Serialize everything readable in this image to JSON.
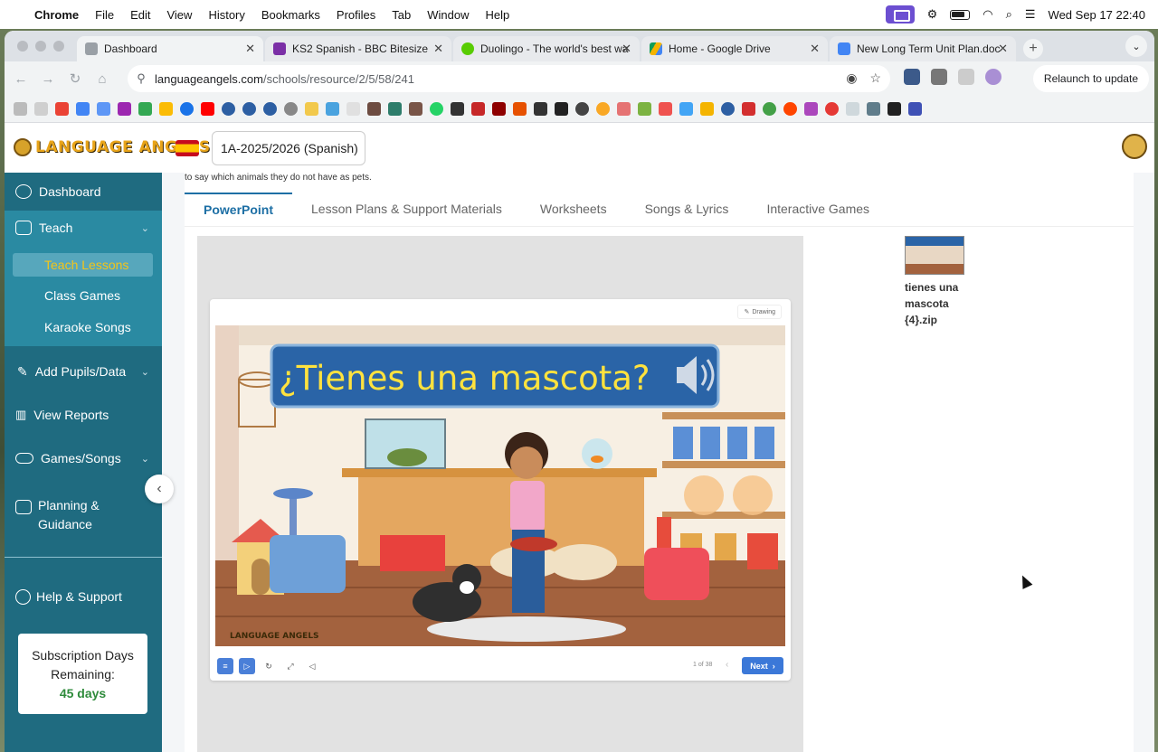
{
  "menubar": {
    "app": "Chrome",
    "items": [
      "File",
      "Edit",
      "View",
      "History",
      "Bookmarks",
      "Profiles",
      "Tab",
      "Window",
      "Help"
    ],
    "clock": "Wed Sep 17  22:40"
  },
  "browser": {
    "tabs": [
      {
        "title": "Dashboard",
        "color": "#9aa0a6"
      },
      {
        "title": "KS2 Spanish - BBC Bitesize",
        "color": "#7b2fa6"
      },
      {
        "title": "Duolingo - The world's best wa",
        "color": "#58cc02"
      },
      {
        "title": "Home - Google Drive",
        "color": "#f4b400"
      },
      {
        "title": "New Long Term Unit Plan.doc",
        "color": "#4285f4"
      }
    ],
    "url_host": "languageangels.com",
    "url_path": "/schools/resource/2/5/58/241",
    "relaunch_label": "Relaunch to update"
  },
  "header": {
    "logo_text": "LANGUAGE ANGELS",
    "class_select": "1A-2025/2026 (Spanish)"
  },
  "sidebar": {
    "dashboard": "Dashboard",
    "teach": "Teach",
    "teach_lessons": "Teach Lessons",
    "class_games": "Class Games",
    "karaoke_songs": "Karaoke Songs",
    "add_pupils": "Add Pupils/Data",
    "view_reports": "View Reports",
    "games_songs": "Games/Songs",
    "planning": "Planning &",
    "guidance": "Guidance",
    "help": "Help & Support",
    "subs_line1": "Subscription Days",
    "subs_line2": "Remaining:",
    "subs_days": "45 days"
  },
  "main": {
    "intro_text": "to say which animals they do not have as pets.",
    "tabs": [
      "PowerPoint",
      "Lesson Plans & Support Materials",
      "Worksheets",
      "Songs & Lyrics",
      "Interactive Games"
    ],
    "draw_label": "Drawing",
    "slide_title": "¿Tienes una mascota?",
    "slide_logo": "LANGUAGE ANGELS",
    "page_count": "1 of 38",
    "next_label": "Next",
    "file_name_lines": [
      "tienes una",
      "mascota",
      "{4}.zip"
    ]
  }
}
